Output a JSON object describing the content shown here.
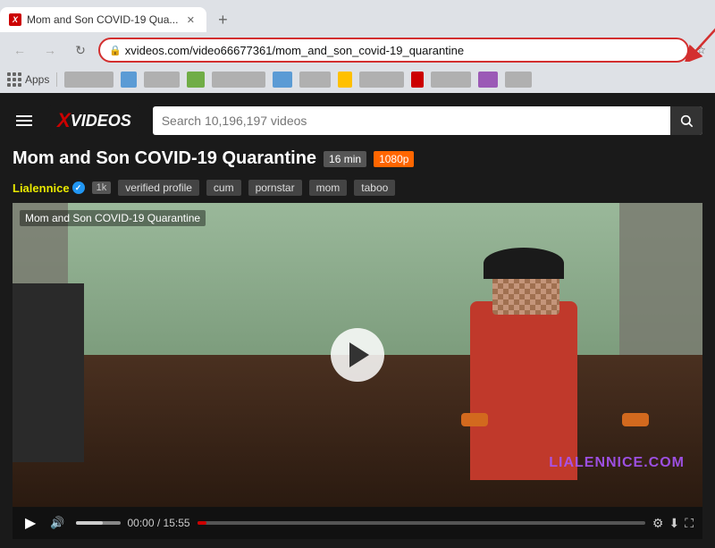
{
  "browser": {
    "tab": {
      "title": "Mom and Son COVID-19 Qua...",
      "favicon": "xv"
    },
    "new_tab_label": "+",
    "address_bar": {
      "url": "xvideos.com/video66677361/mom_and_son_covid-19_quarantine",
      "lock_icon": "🔒"
    },
    "bookmarks_bar": {
      "apps_label": "Apps"
    }
  },
  "xvideos": {
    "logo_x": "X",
    "logo_text": "VIDEOS",
    "search_placeholder": "Search 10,196,197 videos"
  },
  "video": {
    "title": "Mom and Son COVID-19 Quarantine",
    "duration_badge": "16 min",
    "quality_badge": "1080p",
    "author": "Lialennice",
    "author_subscribers": "1k",
    "verified_label": "verified profile",
    "tags": [
      "cum",
      "pornstar",
      "mom",
      "taboo"
    ],
    "overlay_title": "Mom and Son COVID-19 Quarantine",
    "watermark": "LIALENNICE.COM",
    "time_current": "00:00",
    "time_total": "15:55",
    "progress_pct": 2
  },
  "icons": {
    "back": "←",
    "forward": "→",
    "refresh": "↻",
    "search": "🔍",
    "play": "▶",
    "volume": "🔊",
    "settings": "⚙",
    "download": "⬇",
    "fullscreen": "⛶"
  }
}
